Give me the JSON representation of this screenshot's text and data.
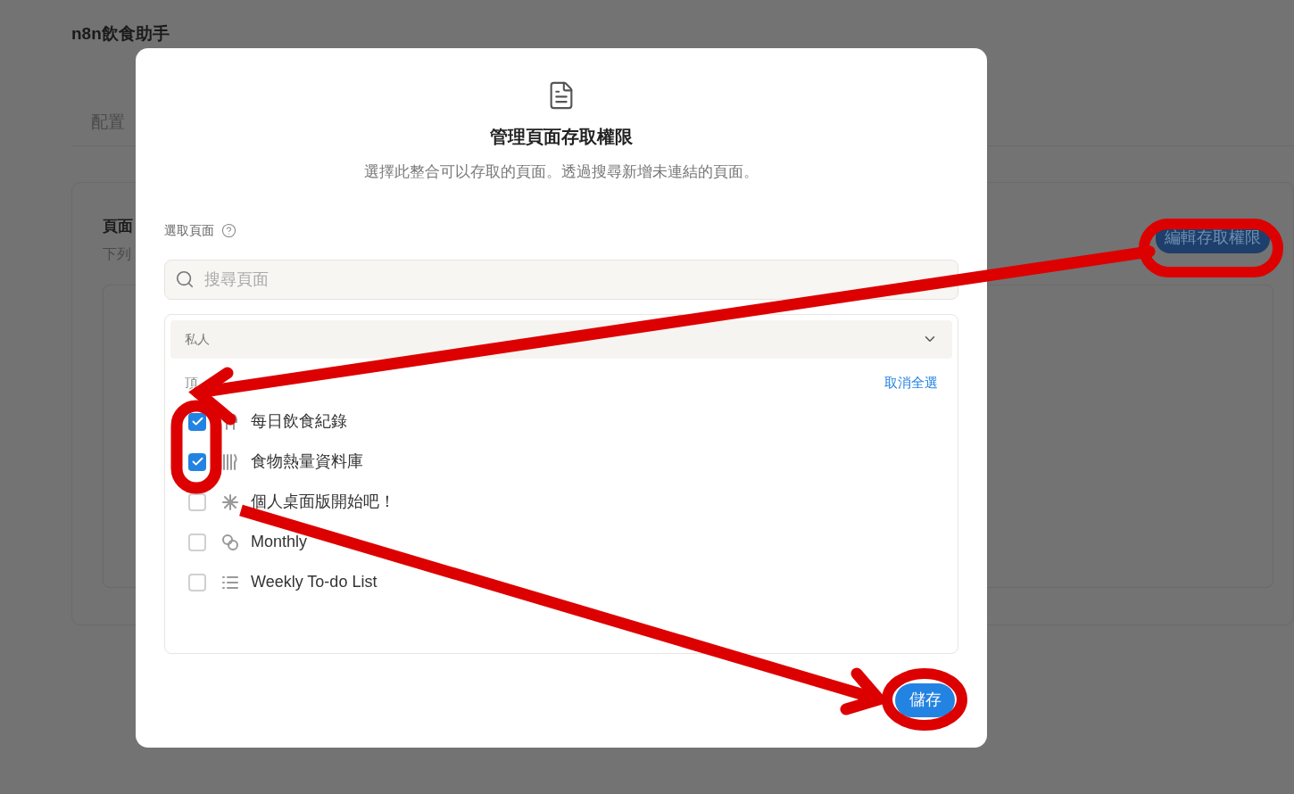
{
  "page": {
    "title": "n8n飲食助手",
    "tabs": [
      {
        "label": "配置",
        "selected": false
      }
    ],
    "card": {
      "title": "頁面",
      "description": "下列",
      "edit_button": "編輯存取權限"
    }
  },
  "dialog": {
    "title": "管理頁面存取權限",
    "subtitle": "選擇此整合可以存取的頁面。透過搜尋新增未連結的頁面。",
    "section_label": "選取頁面",
    "search": {
      "placeholder": "搜尋頁面"
    },
    "group": {
      "label": "私人",
      "expanded": true,
      "subheading": "頂",
      "deselect_all": "取消全選",
      "pages": [
        {
          "title": "每日飲食紀錄",
          "checked": true
        },
        {
          "title": "食物熱量資料庫",
          "checked": true
        },
        {
          "title": "個人桌面版開始吧！",
          "checked": false
        },
        {
          "title": "Monthly",
          "checked": false
        },
        {
          "title": "Weekly To-do List",
          "checked": false
        }
      ]
    },
    "save_button": "儲存"
  }
}
